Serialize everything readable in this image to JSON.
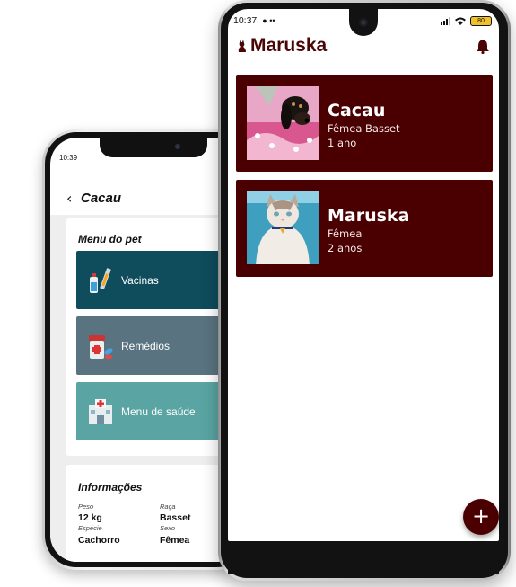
{
  "back_phone": {
    "status_time": "10:39",
    "header": {
      "back_icon": "chevron-left-icon",
      "title": "Cacau",
      "actions": [
        "trash-icon",
        "pencil-icon"
      ]
    },
    "menu": {
      "title": "Menu do pet",
      "items": [
        {
          "label": "Vacinas",
          "icon": "vaccine-icon",
          "color": "#0f4c5c"
        },
        {
          "label": "Remédios",
          "icon": "medicine-icon",
          "color": "#5a7380"
        },
        {
          "label": "Menu de saúde",
          "icon": "hospital-icon",
          "color": "#5aa5a3"
        }
      ]
    },
    "info": {
      "title": "Informações",
      "peso_label": "Peso",
      "peso_value": "12 kg",
      "raca_label": "Raça",
      "raca_value": "Basset",
      "especie_label": "Espécie",
      "especie_value": "Cachorro",
      "sexo_label": "Sexo",
      "sexo_value": "Fêmea"
    }
  },
  "front_phone": {
    "status": {
      "time": "10:37",
      "battery": "80"
    },
    "app_title": "Maruska",
    "pets": [
      {
        "name": "Cacau",
        "description": "Fêmea Basset",
        "age": "1 ano"
      },
      {
        "name": "Maruska",
        "description": "Fêmea",
        "age": "2 anos"
      }
    ],
    "fab_label": "+",
    "colors": {
      "brand": "#4a0000"
    }
  }
}
